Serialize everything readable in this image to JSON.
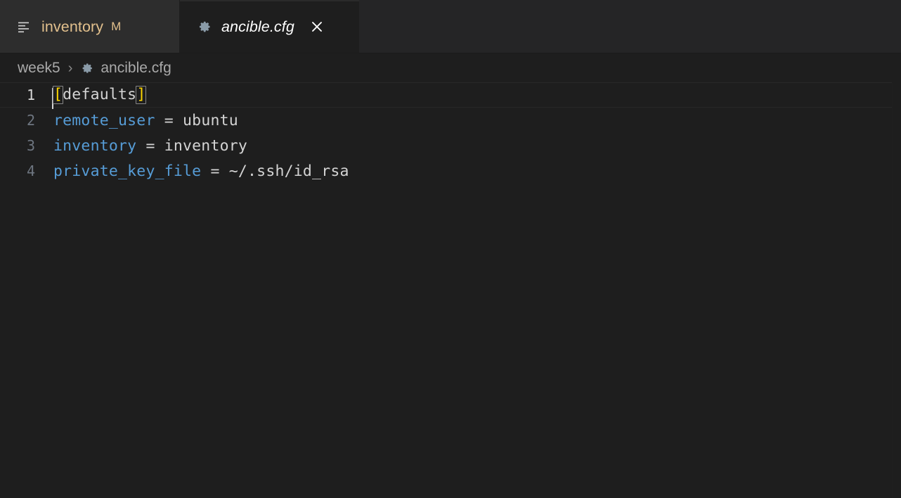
{
  "window": {
    "theme_background": "#1e1e1e",
    "tabbar_background": "#252526"
  },
  "tabs": [
    {
      "label": "inventory",
      "icon": "list-lines-icon",
      "dirty_badge": "M",
      "active": false,
      "color": "#e2c08d"
    },
    {
      "label": "ancible.cfg",
      "icon": "gear-icon",
      "close_label": "×",
      "active": true,
      "preview_italic": true,
      "color": "#ffffff"
    }
  ],
  "breadcrumb": {
    "folder": "week5",
    "separator": "›",
    "file": "ancible.cfg",
    "file_icon": "gear-icon"
  },
  "editor": {
    "language": "ini",
    "cursor_line": 1,
    "cursor_column": 1,
    "lines": [
      {
        "number": "1",
        "active": true,
        "tokens": [
          {
            "text": "[",
            "kind": "bracket",
            "bracket_match": true
          },
          {
            "text": "defaults",
            "kind": "plain"
          },
          {
            "text": "]",
            "kind": "bracket",
            "bracket_match": true
          }
        ]
      },
      {
        "number": "2",
        "active": false,
        "tokens": [
          {
            "text": "remote_user",
            "kind": "key"
          },
          {
            "text": " = ",
            "kind": "op"
          },
          {
            "text": "ubuntu",
            "kind": "plain"
          }
        ]
      },
      {
        "number": "3",
        "active": false,
        "tokens": [
          {
            "text": "inventory",
            "kind": "key"
          },
          {
            "text": " = ",
            "kind": "op"
          },
          {
            "text": "inventory",
            "kind": "plain"
          }
        ]
      },
      {
        "number": "4",
        "active": false,
        "tokens": [
          {
            "text": "private_key_file",
            "kind": "key"
          },
          {
            "text": " = ",
            "kind": "op"
          },
          {
            "text": "~/.ssh/id_rsa",
            "kind": "plain"
          }
        ]
      }
    ],
    "colors": {
      "key": "#569cd6",
      "plain": "#d4d4d4",
      "bracket": "#ffd700",
      "bracket_match_border": "#888888",
      "line_number": "#6e7681",
      "line_number_active": "#d8d8d8",
      "caret": "#d4d4d4"
    }
  }
}
